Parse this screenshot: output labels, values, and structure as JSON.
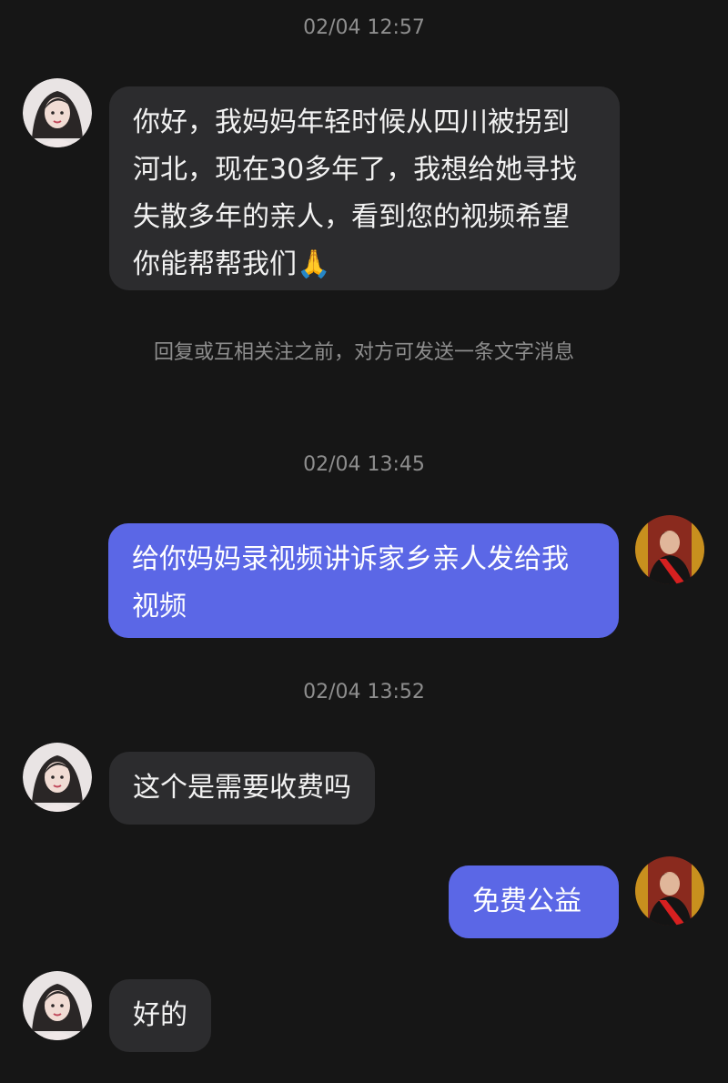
{
  "conversation": {
    "timestamps": [
      "02/04 12:57",
      "02/04 13:45",
      "02/04 13:52"
    ],
    "notice": "回复或互相关注之前，对方可发送一条文字消息",
    "messages": [
      {
        "from": "other",
        "text": "你好，我妈妈年轻时候从四川被拐到河北，现在30多年了，我想给她寻找失散多年的亲人，看到您的视频希望你能帮帮我们🙏"
      },
      {
        "from": "me",
        "text": "给你妈妈录视频讲诉家乡亲人发给我视频"
      },
      {
        "from": "other",
        "text": "这个是需要收费吗"
      },
      {
        "from": "me",
        "text": "免费公益"
      },
      {
        "from": "other",
        "text": "好的"
      }
    ]
  },
  "avatars": {
    "other": "woman-portrait-avatar",
    "me": "man-red-sash-avatar"
  },
  "colors": {
    "background": "#161616",
    "incoming_bubble": "#2c2c2e",
    "outgoing_bubble": "#5b67e6",
    "meta_text": "#8e8e8e"
  }
}
